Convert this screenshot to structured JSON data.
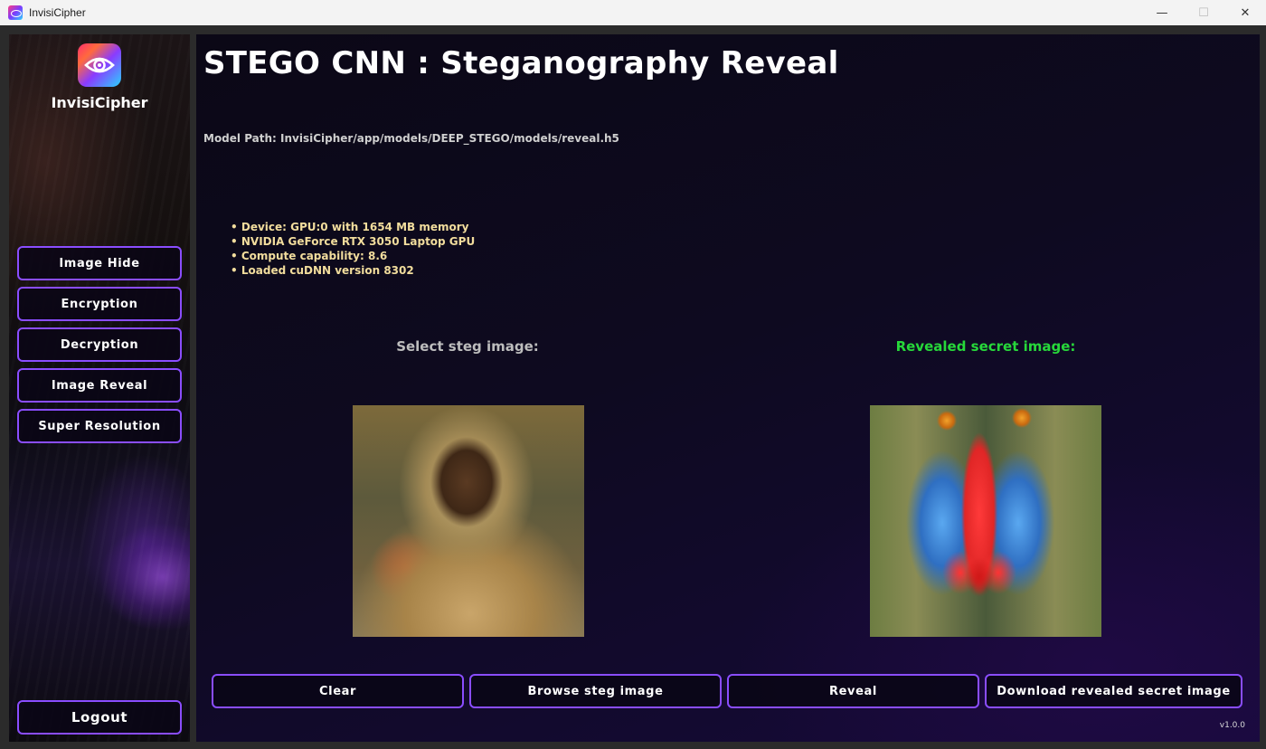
{
  "window": {
    "title": "InvisiCipher",
    "minimize_glyph": "—",
    "maximize_glyph": "☐",
    "close_glyph": "✕"
  },
  "sidebar": {
    "brand": "InvisiCipher",
    "items": [
      {
        "label": "Image Hide"
      },
      {
        "label": "Encryption"
      },
      {
        "label": "Decryption"
      },
      {
        "label": "Image Reveal"
      },
      {
        "label": "Super Resolution"
      }
    ],
    "logout_label": "Logout"
  },
  "main": {
    "title": "STEGO CNN : Steganography Reveal",
    "model_path": "Model Path: InvisiCipher/app/models/DEEP_STEGO/models/reveal.h5",
    "gpu_info": [
      "Device: GPU:0 with 1654 MB memory",
      "NVIDIA GeForce RTX 3050 Laptop GPU",
      "Compute capability: 8.6",
      "Loaded cuDNN version 8302"
    ],
    "steg_label": "Select steg image:",
    "revealed_label": "Revealed secret image:",
    "buttons": {
      "clear": "Clear",
      "browse": "Browse steg image",
      "reveal": "Reveal",
      "download": "Download revealed secret image"
    },
    "version": "v1.0.0"
  },
  "colors": {
    "accent": "#8a4dff",
    "revealed_label": "#27d83a",
    "gpu_text": "#f2dd9d"
  }
}
